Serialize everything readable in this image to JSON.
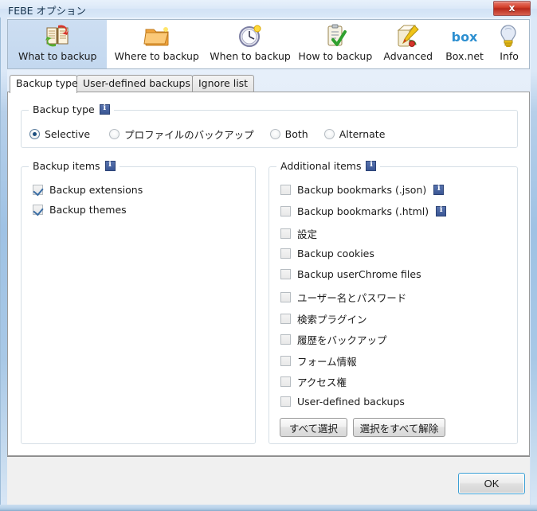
{
  "window": {
    "title": "FEBE オプション",
    "close_label": "x"
  },
  "toolbar": {
    "items": [
      {
        "label": "What to backup",
        "icon": "book-backup-icon",
        "selected": true
      },
      {
        "label": "Where to backup",
        "icon": "folder-icon",
        "selected": false
      },
      {
        "label": "When to backup",
        "icon": "clock-icon",
        "selected": false
      },
      {
        "label": "How to backup",
        "icon": "clipboard-check-icon",
        "selected": false
      },
      {
        "label": "Advanced",
        "icon": "paint-tools-icon",
        "selected": false
      },
      {
        "label": "Box.net",
        "icon": "box-logo-icon",
        "selected": false
      },
      {
        "label": "Info",
        "icon": "lightbulb-icon",
        "selected": false
      }
    ]
  },
  "tabs": [
    {
      "label": "Backup type",
      "active": true
    },
    {
      "label": "User-defined backups",
      "active": false
    },
    {
      "label": "Ignore list",
      "active": false
    }
  ],
  "backup_type_group": {
    "legend": "Backup type",
    "info_icon": "info-icon",
    "options": [
      {
        "label": "Selective",
        "checked": true
      },
      {
        "label": "プロファイルのバックアップ",
        "checked": false
      },
      {
        "label": "Both",
        "checked": false
      },
      {
        "label": "Alternate",
        "checked": false
      }
    ]
  },
  "backup_items_group": {
    "legend": "Backup items",
    "info_icon": "info-icon",
    "items": [
      {
        "label": "Backup extensions",
        "checked": true,
        "info": false
      },
      {
        "label": "Backup themes",
        "checked": true,
        "info": false
      }
    ]
  },
  "additional_items_group": {
    "legend": "Additional items",
    "info_icon": "info-icon",
    "items": [
      {
        "label": "Backup bookmarks (.json)",
        "checked": false,
        "info": true
      },
      {
        "label": "Backup bookmarks (.html)",
        "checked": false,
        "info": true
      },
      {
        "label": "設定",
        "checked": false,
        "info": false
      },
      {
        "label": "Backup cookies",
        "checked": false,
        "info": false
      },
      {
        "label": "Backup userChrome files",
        "checked": false,
        "info": false
      },
      {
        "label": "ユーザー名とパスワード",
        "checked": false,
        "info": false
      },
      {
        "label": "検索プラグイン",
        "checked": false,
        "info": false
      },
      {
        "label": "履歴をバックアップ",
        "checked": false,
        "info": false
      },
      {
        "label": "フォーム情報",
        "checked": false,
        "info": false
      },
      {
        "label": "アクセス権",
        "checked": false,
        "info": false
      },
      {
        "label": "User-defined backups",
        "checked": false,
        "info": false
      }
    ],
    "select_all_label": "すべて選択",
    "deselect_all_label": "選択をすべて解除"
  },
  "footer": {
    "ok_label": "OK"
  },
  "colors": {
    "accent": "#3c9fd4",
    "title_bar": "#d9e8f8",
    "selected_tab_bg": "#c8daf0",
    "close_button": "#d4412c",
    "info_badge": "#3a5694",
    "checkmark": "#3b6ea5"
  }
}
